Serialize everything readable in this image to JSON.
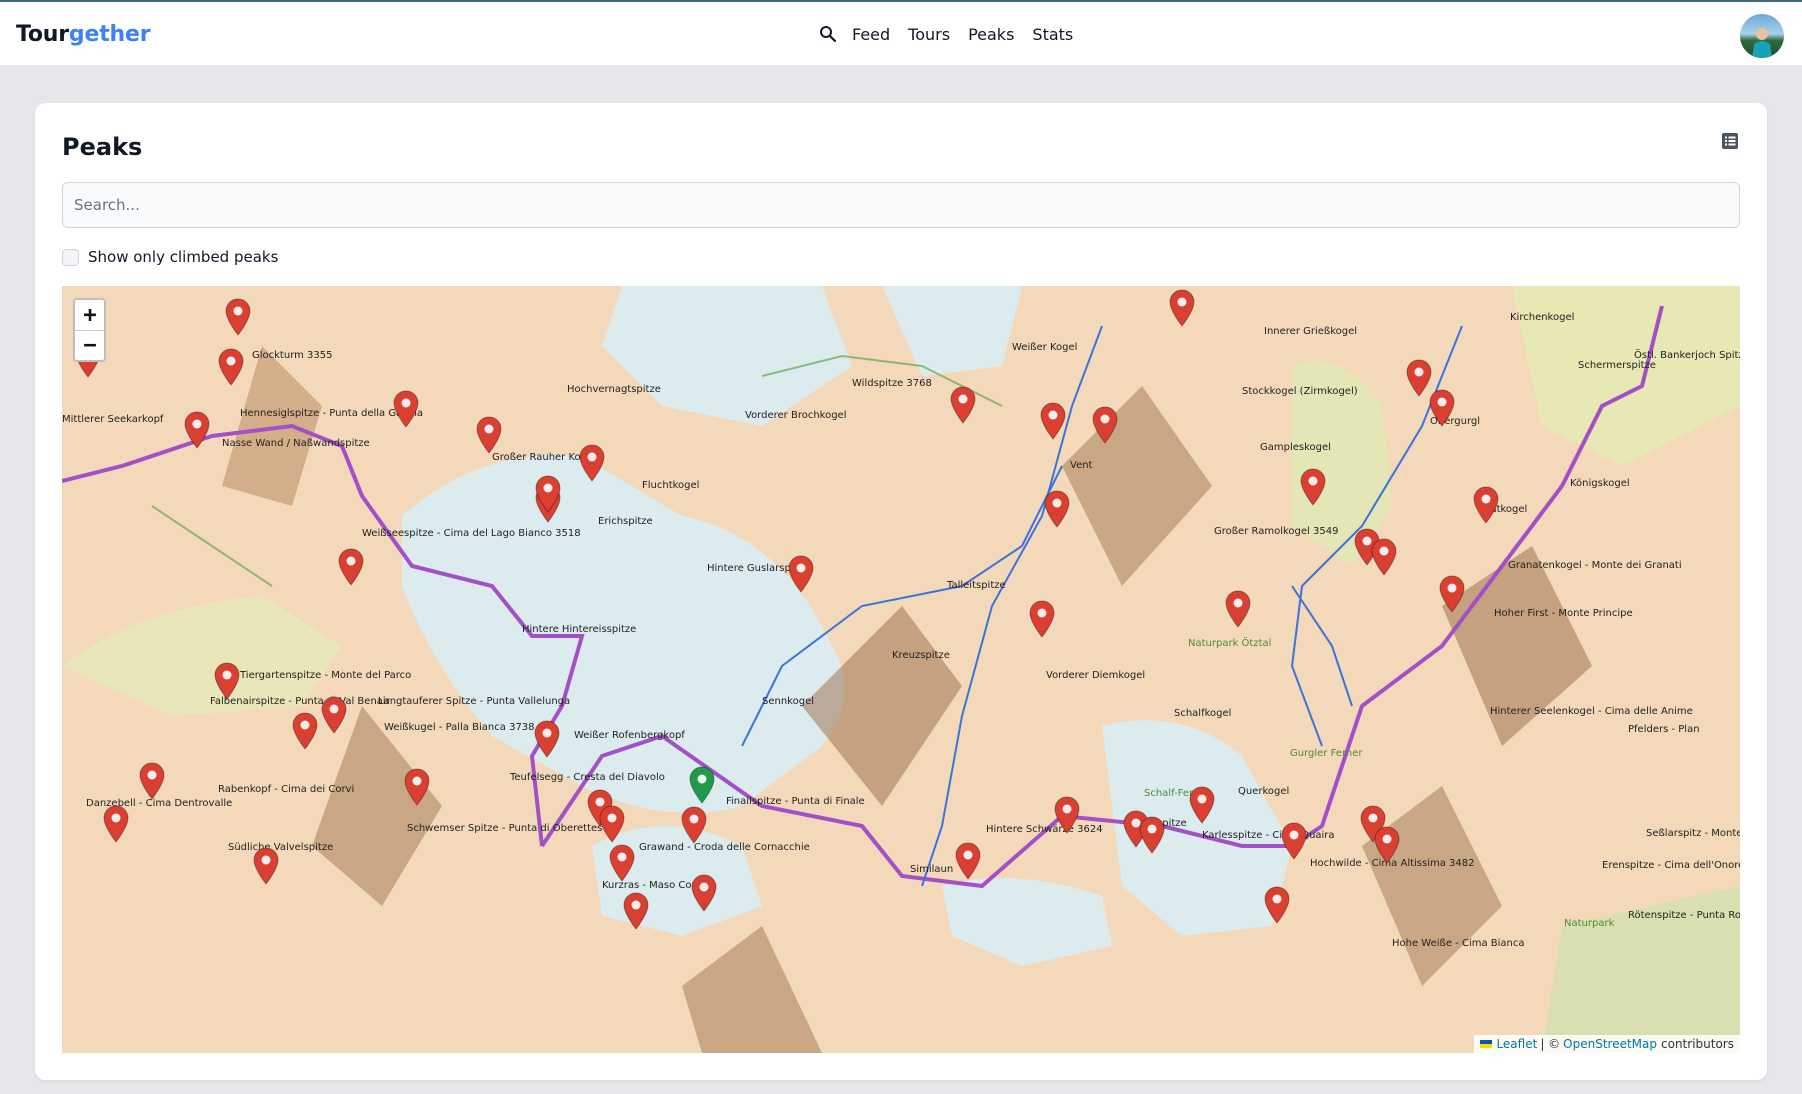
{
  "navbar": {
    "brand_part1": "Tour",
    "brand_part2": "gether",
    "search_icon": "search-icon",
    "links": [
      "Feed",
      "Tours",
      "Peaks",
      "Stats"
    ],
    "avatar": "user-avatar"
  },
  "page": {
    "title": "Peaks",
    "list_view_icon": "list-icon",
    "search_placeholder": "Search...",
    "search_value": "",
    "climbed_only_label": "Show only climbed peaks",
    "climbed_only_checked": false
  },
  "map": {
    "zoom_in_label": "+",
    "zoom_out_label": "−",
    "attribution": {
      "leaflet": "Leaflet",
      "separator": "| ©",
      "osm": "OpenStreetMap",
      "contributors": "contributors"
    },
    "colors": {
      "peak_marker": "#d94032",
      "climbed_marker": "#1f9a4a",
      "border": "#a350c8",
      "river": "#3b73d9",
      "glacier": "#dcebee",
      "terrain": "#f1d4b3"
    },
    "labels": [
      "Glockturm 3355",
      "Mittlerer Seekarkopf",
      "Hennesiglspitze - Punta della Gallina",
      "Nasse Wand / Naßwandspitze",
      "Hochvernagtspitze",
      "Wildspitze 3768",
      "Weißer Kogel",
      "Vorderer Brochkogel",
      "Großer Rauher Kopf",
      "Fluchtkogel",
      "Erichspitze",
      "Weißseespitze - Cima del Lago Bianco 3518",
      "Hintere Guslarspitze",
      "Vent",
      "Stockkogel (Zirmkogel)",
      "Gampleskogel",
      "Obergurgl",
      "Innerer Grießkogel",
      "Kirchenkogel",
      "Schermerspitze",
      "Östl. Bankerjoch Spitze",
      "Königskogel",
      "Festkogel",
      "Großer Ramolkogel 3549",
      "Granatenkogel - Monte dei Granati",
      "Hoher First - Monte Principe",
      "Talleitspitze",
      "Hintere Hintereisspitze",
      "Kreuzspitze",
      "Naturpark Ötztal",
      "Vorderer Diemkogel",
      "Tiergartenspitze - Monte del Parco",
      "Falbenairspitze - Punta di Val Benair",
      "Langtauferer Spitze - Punta Vallelunga",
      "Weißkugel - Palla Bianca 3738",
      "Sennkogel",
      "Schalfkogel",
      "Hinterer Seelenkogel - Cima delle Anime",
      "Pfelders - Plan",
      "Weißer Rofenbergkopf",
      "Teufelsegg - Cresta del Diavolo",
      "Danzebell - Cima Dentrovalle",
      "Rabenkopf - Cima dei Corvi",
      "Finailspitze - Punta di Finale",
      "Schalf-Ferner",
      "Querkogel",
      "Gurgler Ferner",
      "Schwemser Spitze - Punta di Oberettes",
      "Grawand - Croda delle Cornacchie",
      "Kurzras - Maso Corto",
      "Hintere Schwärze 3624",
      "Rötenspitze",
      "Karlesspitze - Cima Quaira",
      "Hochwilde - Cima Altissima 3482",
      "Seßlarspitz - Monte Tavolino",
      "Erenspitze - Cima dell'Onore",
      "Similaun",
      "Südliche Valvelspitze",
      "Hohe Weiße - Cima Bianca",
      "Rötenspitze - Punta Rossa",
      "Naturpark"
    ],
    "marker_count": 48,
    "climbed_count": 1
  }
}
